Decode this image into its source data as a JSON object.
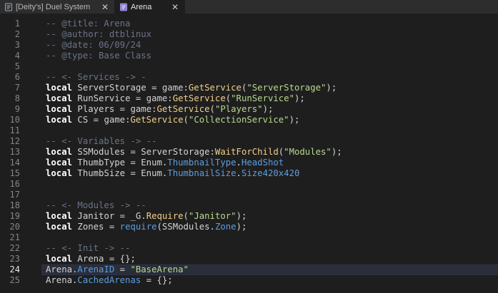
{
  "tabs": [
    {
      "label": "[Deity's] Duel System",
      "icon": "script-icon",
      "close": "✕"
    },
    {
      "label": "Arena",
      "icon": "module-script-icon",
      "close": "✕"
    }
  ],
  "colors": {
    "keyword": "#ffffff",
    "comment": "#6a7387",
    "string": "#b8d98f",
    "method": "#f0d08a",
    "enum": "#5c9ee0",
    "text": "#d4d4d4",
    "current_line": "#2a2d3a",
    "tab_icon": "#8a7bd0"
  },
  "editor": {
    "current_line": 24,
    "lines": [
      {
        "n": "1",
        "tokens": [
          {
            "t": "-- @title: Arena",
            "c": "comment"
          }
        ]
      },
      {
        "n": "2",
        "tokens": [
          {
            "t": "-- @author: dtblinux",
            "c": "comment"
          }
        ]
      },
      {
        "n": "3",
        "tokens": [
          {
            "t": "-- @date: 06/09/24",
            "c": "comment"
          }
        ]
      },
      {
        "n": "4",
        "tokens": [
          {
            "t": "-- @type: Base Class",
            "c": "comment"
          }
        ]
      },
      {
        "n": "5",
        "tokens": []
      },
      {
        "n": "6",
        "tokens": [
          {
            "t": "-- <- Services -> -",
            "c": "comment"
          }
        ]
      },
      {
        "n": "7",
        "tokens": [
          {
            "t": "local",
            "c": "kw"
          },
          {
            "t": " ServerStorage = game:",
            "c": "id"
          },
          {
            "t": "GetService",
            "c": "method"
          },
          {
            "t": "(",
            "c": "op"
          },
          {
            "t": "\"ServerStorage\"",
            "c": "str"
          },
          {
            "t": ");",
            "c": "op"
          }
        ]
      },
      {
        "n": "8",
        "tokens": [
          {
            "t": "local",
            "c": "kw"
          },
          {
            "t": " RunService = game:",
            "c": "id"
          },
          {
            "t": "GetService",
            "c": "method"
          },
          {
            "t": "(",
            "c": "op"
          },
          {
            "t": "\"RunService\"",
            "c": "str"
          },
          {
            "t": ");",
            "c": "op"
          }
        ]
      },
      {
        "n": "9",
        "tokens": [
          {
            "t": "local",
            "c": "kw"
          },
          {
            "t": " Players = game:",
            "c": "id"
          },
          {
            "t": "GetService",
            "c": "method"
          },
          {
            "t": "(",
            "c": "op"
          },
          {
            "t": "\"Players\"",
            "c": "str"
          },
          {
            "t": ");",
            "c": "op"
          }
        ]
      },
      {
        "n": "10",
        "tokens": [
          {
            "t": "local",
            "c": "kw"
          },
          {
            "t": " CS = game:",
            "c": "id"
          },
          {
            "t": "GetService",
            "c": "method"
          },
          {
            "t": "(",
            "c": "op"
          },
          {
            "t": "\"CollectionService\"",
            "c": "str"
          },
          {
            "t": ");",
            "c": "op"
          }
        ]
      },
      {
        "n": "11",
        "tokens": []
      },
      {
        "n": "12",
        "tokens": [
          {
            "t": "-- <- Variables -> --",
            "c": "comment"
          }
        ]
      },
      {
        "n": "13",
        "tokens": [
          {
            "t": "local",
            "c": "kw"
          },
          {
            "t": " SSModules = ServerStorage:",
            "c": "id"
          },
          {
            "t": "WaitForChild",
            "c": "method"
          },
          {
            "t": "(",
            "c": "op"
          },
          {
            "t": "\"Modules\"",
            "c": "str"
          },
          {
            "t": ");",
            "c": "op"
          }
        ]
      },
      {
        "n": "14",
        "tokens": [
          {
            "t": "local",
            "c": "kw"
          },
          {
            "t": " ThumbType = Enum.",
            "c": "id"
          },
          {
            "t": "ThumbnailType",
            "c": "enum"
          },
          {
            "t": ".",
            "c": "op"
          },
          {
            "t": "HeadShot",
            "c": "enum"
          }
        ]
      },
      {
        "n": "15",
        "tokens": [
          {
            "t": "local",
            "c": "kw"
          },
          {
            "t": " ThumbSize = Enum.",
            "c": "id"
          },
          {
            "t": "ThumbnailSize",
            "c": "enum"
          },
          {
            "t": ".",
            "c": "op"
          },
          {
            "t": "Size420x420",
            "c": "enum"
          }
        ]
      },
      {
        "n": "16",
        "tokens": []
      },
      {
        "n": "17",
        "tokens": []
      },
      {
        "n": "18",
        "tokens": [
          {
            "t": "-- <- Modules -> --",
            "c": "comment"
          }
        ]
      },
      {
        "n": "19",
        "tokens": [
          {
            "t": "local",
            "c": "kw"
          },
          {
            "t": " Janitor = _G.",
            "c": "id"
          },
          {
            "t": "Require",
            "c": "method"
          },
          {
            "t": "(",
            "c": "op"
          },
          {
            "t": "\"Janitor\"",
            "c": "str"
          },
          {
            "t": ");",
            "c": "op"
          }
        ]
      },
      {
        "n": "20",
        "tokens": [
          {
            "t": "local",
            "c": "kw"
          },
          {
            "t": " Zones = ",
            "c": "id"
          },
          {
            "t": "require",
            "c": "enum"
          },
          {
            "t": "(SSModules.",
            "c": "op"
          },
          {
            "t": "Zone",
            "c": "enum"
          },
          {
            "t": ");",
            "c": "op"
          }
        ]
      },
      {
        "n": "21",
        "tokens": []
      },
      {
        "n": "22",
        "tokens": [
          {
            "t": "-- <- Init -> --",
            "c": "comment"
          }
        ]
      },
      {
        "n": "23",
        "tokens": [
          {
            "t": "local",
            "c": "kw"
          },
          {
            "t": " Arena = {};",
            "c": "id"
          }
        ]
      },
      {
        "n": "24",
        "tokens": [
          {
            "t": "Arena.",
            "c": "id"
          },
          {
            "t": "ArenaID",
            "c": "enum"
          },
          {
            "t": " = ",
            "c": "op"
          },
          {
            "t": "\"BaseArena\"",
            "c": "str"
          }
        ]
      },
      {
        "n": "25",
        "tokens": [
          {
            "t": "Arena.",
            "c": "id"
          },
          {
            "t": "CachedArenas",
            "c": "enum"
          },
          {
            "t": " = {};",
            "c": "op"
          }
        ]
      }
    ]
  }
}
